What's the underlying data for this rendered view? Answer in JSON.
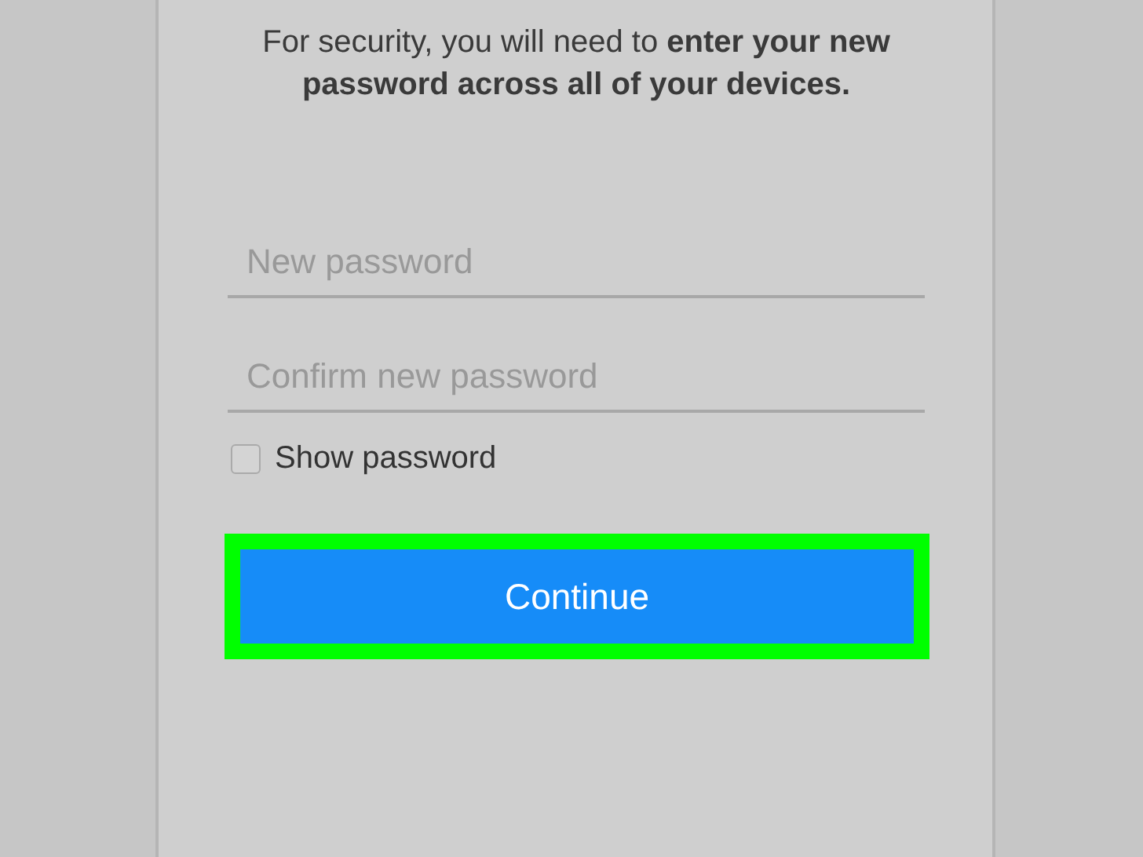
{
  "message": "For security, you will need to **enter your new password across all of your devices.**",
  "fields": [
    {
      "placeholder": "New password"
    },
    {
      "placeholder": "Confirm new password"
    }
  ],
  "show_password": {
    "label": "Show password",
    "checked": false
  },
  "continue_button": {
    "label": "Continue",
    "highlighted": true
  }
}
